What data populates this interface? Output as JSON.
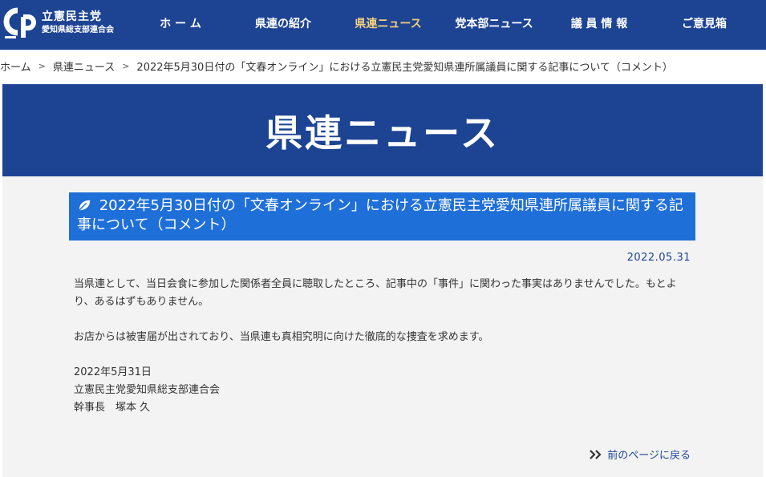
{
  "header": {
    "logo": {
      "mark": "CDP",
      "line1": "立憲民主党",
      "line2": "愛知県総支部連合会"
    },
    "nav": [
      {
        "label": "ホ ー ム",
        "active": false
      },
      {
        "label": "県連の紹介",
        "active": false
      },
      {
        "label": "県連ニュース",
        "active": true
      },
      {
        "label": "党本部ニュース",
        "active": false
      },
      {
        "label": "議 員 情 報",
        "active": false
      },
      {
        "label": "ご意見箱",
        "active": false
      }
    ]
  },
  "breadcrumb": {
    "items": [
      "ホーム",
      "県連ニュース",
      "2022年5月30日付の「文春オンライン」における立憲民主党愛知県連所属議員に関する記事について（コメント）"
    ],
    "separator": ">"
  },
  "hero": {
    "title": "県連ニュース"
  },
  "article": {
    "title_icon": "leaf-icon",
    "title": "2022年5月30日付の「文春オンライン」における立憲民主党愛知県連所属議員に関する記事について（コメント）",
    "date": "2022.05.31",
    "paragraphs": [
      "当県連として、当日会食に参加した関係者全員に聴取したところ、記事中の「事件」に関わった事実はありませんでした。もとより、あるはずもありません。",
      "お店からは被害届が出されており、当県連も真相究明に向けた徹底的な捜査を求めます。"
    ],
    "signature": {
      "date": "2022年5月31日",
      "org": "立憲民主党愛知県総支部連合会",
      "person": "幹事長　塚本 久"
    }
  },
  "back_link": {
    "icon": "double-chevron-right-icon",
    "label": "前のページに戻る"
  },
  "colors": {
    "primary": "#1d4393",
    "title_bar": "#1f6fd9",
    "active_nav": "#f5d07b",
    "content_bg": "#f3f3f3"
  }
}
